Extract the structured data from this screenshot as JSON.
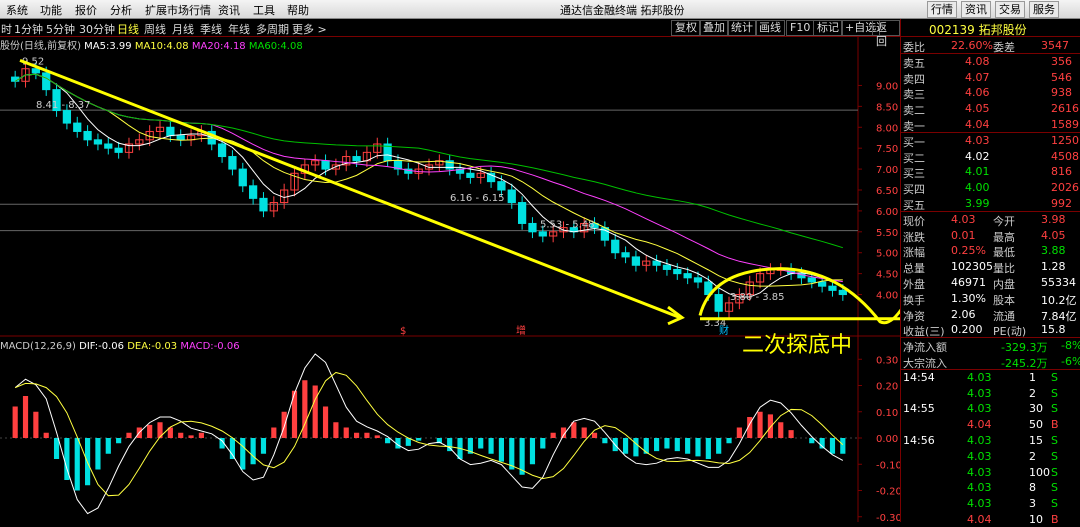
{
  "menu": {
    "items": [
      "系统",
      "功能",
      "报价",
      "分析",
      "扩展市场行情",
      "资讯",
      "工具",
      "帮助"
    ],
    "title": "通达信金融终端  拓邦股份",
    "right_buttons": [
      "行情",
      "资讯",
      "交易",
      "服务"
    ]
  },
  "toolbar": {
    "periods": [
      "1分钟",
      "5分钟",
      "30分钟",
      "日线",
      "周线",
      "月线",
      "季线",
      "年线",
      "多周期",
      "更多 >"
    ],
    "active": "日线",
    "first": "时",
    "buttons": [
      "复权",
      "叠加",
      "统计",
      "画线",
      "F10",
      "标记",
      "+自选",
      "返回"
    ]
  },
  "indicator": {
    "name": "股份(日线,前复权)",
    "ma_label": "MA5:",
    "ma5": "3.99",
    "ma10_label": "MA10:",
    "ma10": "4.08",
    "ma20_label": "MA20:",
    "ma20": "4.18",
    "ma60_label": "MA60:",
    "ma60": "4.08"
  },
  "macd": {
    "name": "MACD(12,26,9)",
    "dif_label": "DIF:",
    "dif": "-0.06",
    "dea_label": "DEA:",
    "dea": "-0.03",
    "macd_label": "MACD:",
    "macd": "-0.06"
  },
  "colors": {
    "up": "#ff4040",
    "down": "#00e0e0",
    "trend": "#ffff00",
    "ma5": "#ffffff",
    "ma10": "#ffff40",
    "ma20": "#ff40ff",
    "ma60": "#00c000"
  },
  "chart_data": [
    {
      "type": "candlestick",
      "title": "日线",
      "ylim": [
        3.2,
        9.8
      ],
      "yticks": [
        "9.00",
        "8.50",
        "8.00",
        "7.50",
        "7.00",
        "6.50",
        "6.00",
        "5.50",
        "5.00",
        "4.50",
        "4.00"
      ],
      "annotations": [
        "9.52",
        "8.41 - 8.37",
        "6.16 - 6.15",
        "5.53 - 5.48",
        "3.80 - 3.85",
        "3.34"
      ],
      "markers": [
        "$",
        "增",
        "财"
      ],
      "close": [
        9.1,
        9.4,
        9.3,
        8.9,
        8.4,
        8.1,
        7.9,
        7.7,
        7.6,
        7.5,
        7.4,
        7.6,
        7.7,
        7.9,
        8.0,
        7.8,
        7.7,
        7.8,
        7.9,
        7.6,
        7.3,
        7.0,
        6.6,
        6.3,
        6.0,
        6.2,
        6.5,
        6.9,
        7.1,
        7.2,
        7.0,
        7.1,
        7.3,
        7.2,
        7.4,
        7.6,
        7.2,
        7.0,
        6.9,
        7.0,
        7.1,
        7.2,
        7.0,
        6.9,
        6.8,
        6.9,
        6.7,
        6.5,
        6.2,
        5.7,
        5.5,
        5.4,
        5.5,
        5.6,
        5.5,
        5.7,
        5.6,
        5.3,
        5.0,
        4.9,
        4.7,
        4.8,
        4.7,
        4.6,
        4.5,
        4.4,
        4.3,
        4.0,
        3.6,
        3.8,
        4.0,
        4.3,
        4.5,
        4.6,
        4.6,
        4.5,
        4.4,
        4.3,
        4.2,
        4.1,
        4.0
      ]
    },
    {
      "type": "bar",
      "title": "MACD",
      "ylim": [
        -0.32,
        0.32
      ],
      "yticks": [
        "0.30",
        "0.20",
        "0.10",
        "0.00",
        "-0.10",
        "-0.20",
        "-0.30"
      ],
      "values": [
        0.12,
        0.16,
        0.1,
        0.02,
        -0.08,
        -0.16,
        -0.2,
        -0.18,
        -0.12,
        -0.06,
        -0.02,
        0.02,
        0.04,
        0.05,
        0.06,
        0.04,
        0.02,
        0.01,
        0.02,
        0.0,
        -0.04,
        -0.08,
        -0.12,
        -0.1,
        -0.06,
        0.04,
        0.1,
        0.18,
        0.22,
        0.2,
        0.12,
        0.06,
        0.04,
        0.02,
        0.02,
        0.01,
        -0.02,
        -0.04,
        -0.03,
        -0.01,
        0.0,
        -0.02,
        -0.05,
        -0.08,
        -0.06,
        -0.04,
        -0.06,
        -0.09,
        -0.12,
        -0.14,
        -0.1,
        -0.04,
        0.02,
        0.04,
        0.06,
        0.04,
        0.02,
        -0.02,
        -0.05,
        -0.06,
        -0.07,
        -0.06,
        -0.05,
        -0.04,
        -0.05,
        -0.06,
        -0.07,
        -0.08,
        -0.06,
        -0.02,
        0.04,
        0.08,
        0.1,
        0.09,
        0.06,
        0.03,
        0.0,
        -0.02,
        -0.04,
        -0.06,
        -0.06
      ]
    }
  ],
  "note": "二次探底中",
  "quote": {
    "code_name": "002139 拓邦股份",
    "webi_label": "委比",
    "webi": "22.60%",
    "weicha_label": "委差",
    "weicha": "3547",
    "asks": [
      {
        "label": "卖五",
        "price": "4.08",
        "vol": "356"
      },
      {
        "label": "卖四",
        "price": "4.07",
        "vol": "546"
      },
      {
        "label": "卖三",
        "price": "4.06",
        "vol": "938"
      },
      {
        "label": "卖二",
        "price": "4.05",
        "vol": "2616"
      },
      {
        "label": "卖一",
        "price": "4.04",
        "vol": "1589"
      }
    ],
    "bids": [
      {
        "label": "买一",
        "price": "4.03",
        "vol": "1250"
      },
      {
        "label": "买二",
        "price": "4.02",
        "vol": "4508"
      },
      {
        "label": "买三",
        "price": "4.01",
        "vol": "816"
      },
      {
        "label": "买四",
        "price": "4.00",
        "vol": "2026"
      },
      {
        "label": "买五",
        "price": "3.99",
        "vol": "992"
      }
    ],
    "stats": [
      {
        "l1": "现价",
        "v1": "4.03",
        "l2": "今开",
        "v2": "3.98"
      },
      {
        "l1": "涨跌",
        "v1": "0.01",
        "l2": "最高",
        "v2": "4.05"
      },
      {
        "l1": "涨幅",
        "v1": "0.25%",
        "l2": "最低",
        "v2": "3.88"
      },
      {
        "l1": "总量",
        "v1": "102305",
        "l2": "量比",
        "v2": "1.28"
      },
      {
        "l1": "外盘",
        "v1": "46971",
        "l2": "内盘",
        "v2": "55334"
      },
      {
        "l1": "换手",
        "v1": "1.30%",
        "l2": "股本",
        "v2": "10.2亿"
      },
      {
        "l1": "净资",
        "v1": "2.06",
        "l2": "流通",
        "v2": "7.84亿"
      },
      {
        "l1": "收益(三)",
        "v1": "0.200",
        "l2": "PE(动)",
        "v2": "15.8"
      }
    ],
    "flows": [
      {
        "label": "净流入额",
        "value": "-329.3万",
        "pct": "-8%"
      },
      {
        "label": "大宗流入",
        "value": "-245.2万",
        "pct": "-6%"
      }
    ],
    "ticks": [
      {
        "time": "14:54",
        "price": "4.03",
        "vol": "1",
        "side": "S"
      },
      {
        "time": "",
        "price": "4.03",
        "vol": "2",
        "side": "S"
      },
      {
        "time": "14:55",
        "price": "4.03",
        "vol": "30",
        "side": "S"
      },
      {
        "time": "",
        "price": "4.04",
        "vol": "50",
        "side": "B"
      },
      {
        "time": "14:56",
        "price": "4.03",
        "vol": "15",
        "side": "S"
      },
      {
        "time": "",
        "price": "4.03",
        "vol": "2",
        "side": "S"
      },
      {
        "time": "",
        "price": "4.03",
        "vol": "100",
        "side": "S"
      },
      {
        "time": "",
        "price": "4.03",
        "vol": "8",
        "side": "S"
      },
      {
        "time": "",
        "price": "4.03",
        "vol": "3",
        "side": "S"
      },
      {
        "time": "",
        "price": "4.04",
        "vol": "10",
        "side": "B"
      }
    ]
  }
}
